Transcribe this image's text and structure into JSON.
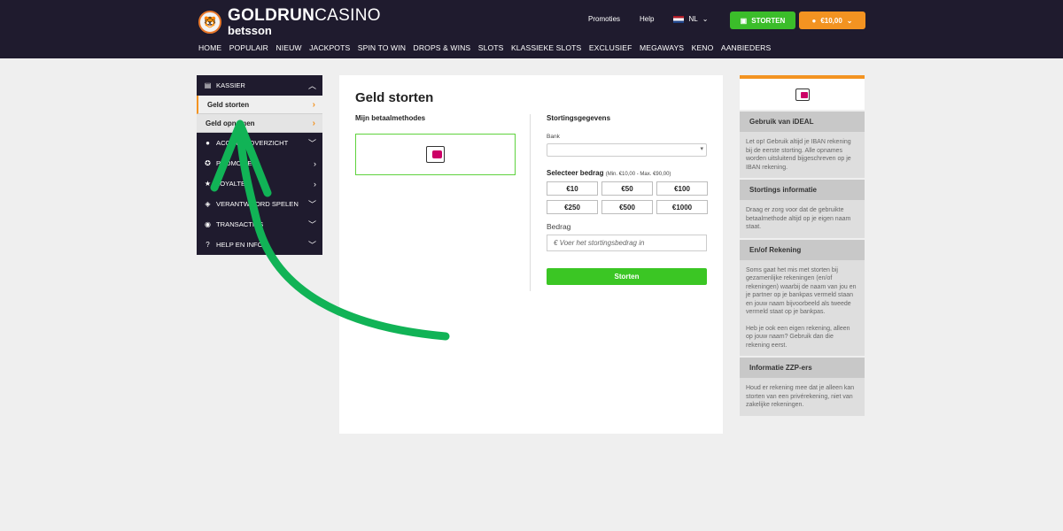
{
  "header": {
    "logo_line1_bold": "GOLDRUN",
    "logo_line1_thin": "CASINO",
    "logo_line2": "betsson",
    "links": {
      "promoties": "Promoties",
      "help": "Help",
      "language": "NL"
    },
    "deposit_button": "STORTEN",
    "balance": "€10,00"
  },
  "nav": [
    "HOME",
    "POPULAIR",
    "NIEUW",
    "JACKPOTS",
    "SPIN TO WIN",
    "DROPS & WINS",
    "SLOTS",
    "KLASSIEKE SLOTS",
    "EXCLUSIEF",
    "MEGAWAYS",
    "KENO",
    "AANBIEDERS"
  ],
  "sidebar": {
    "kassier": "KASSIER",
    "geld_storten": "Geld storten",
    "geld_opnemen": "Geld opnemen",
    "items": [
      "ACCOUNTOVERZICHT",
      "PROMOTIES",
      "LOYALTEIT",
      "VERANTWOORD SPELEN",
      "TRANSACTIES",
      "HELP EN INFO"
    ]
  },
  "main": {
    "title": "Geld storten",
    "methods_title": "Mijn betaalmethodes",
    "details_title": "Stortingsgegevens",
    "bank_label": "Bank",
    "amount_title": "Selecteer bedrag",
    "amount_range": "(Min. €10,00 - Max. €90,00)",
    "amounts": [
      "€10",
      "€50",
      "€100",
      "€250",
      "€500",
      "€1000"
    ],
    "bedrag_label": "Bedrag",
    "bedrag_placeholder": "€ Voer het stortingsbedrag in",
    "submit": "Storten"
  },
  "info": {
    "sections": [
      {
        "title": "Gebruik van iDEAL",
        "body": [
          "Let op! Gebruik altijd je IBAN rekening bij de eerste storting. Alle opnames worden uitsluitend bijgeschreven op je IBAN rekening."
        ]
      },
      {
        "title": "Stortings informatie",
        "body": [
          "Draag er zorg voor dat de gebruikte betaalmethode altijd op je eigen naam staat."
        ]
      },
      {
        "title": "En/of Rekening",
        "body": [
          "Soms gaat het mis met storten bij gezamenlijke rekeningen (en/of rekeningen) waarbij de naam van jou en je partner op je bankpas vermeld staan en jouw naam bijvoorbeeld als tweede vermeld staat op je bankpas.",
          "Heb je ook een eigen rekening, alleen op jouw naam? Gebruik dan die rekening eerst."
        ]
      },
      {
        "title": "Informatie ZZP-ers",
        "body": [
          "Houd er rekening mee dat je alleen kan storten van een privérekening, niet van zakelijke rekeningen."
        ]
      }
    ]
  },
  "colors": {
    "header_bg": "#1f1b2e",
    "green": "#3bc624",
    "orange": "#f39321",
    "arrow": "#11b356"
  }
}
